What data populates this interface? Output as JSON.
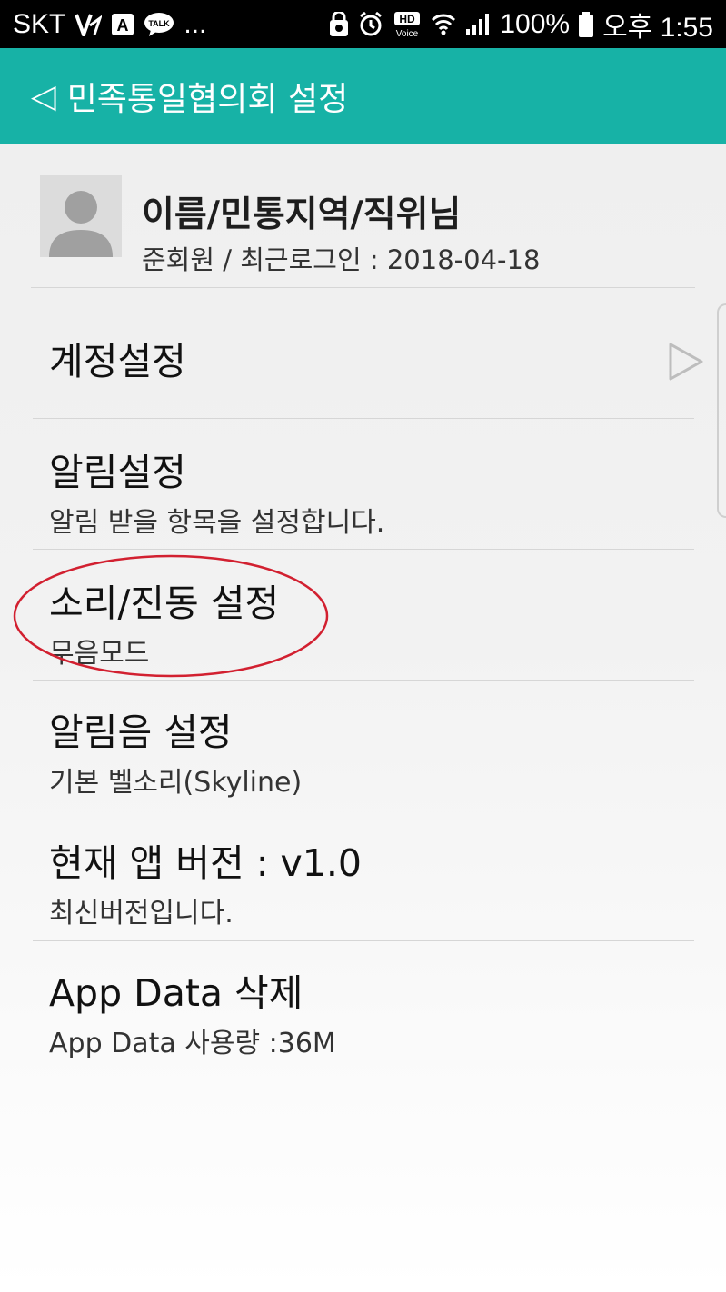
{
  "status_bar": {
    "carrier": "SKT",
    "battery": "100%",
    "time": "오후 1:55",
    "more": "...",
    "hd_voice_top": "HD",
    "hd_voice_bottom": "Voice",
    "talk_badge": "TALK",
    "a_badge": "A"
  },
  "app_bar": {
    "back_icon": "◁",
    "title": "민족통일협의회 설정",
    "color": "#17b2a6"
  },
  "profile": {
    "name": "이름/민통지역/직위님",
    "info": "준회원 / 최근로그인 : 2018-04-18"
  },
  "settings": [
    {
      "title": "계정설정",
      "subtitle": "",
      "has_arrow": true
    },
    {
      "title": "알림설정",
      "subtitle": "알림 받을 항목을 설정합니다."
    },
    {
      "title": "소리/진동 설정",
      "subtitle": "무음모드"
    },
    {
      "title": "알림음 설정",
      "subtitle": "기본 벨소리(Skyline)"
    },
    {
      "title": "현재 앱 버전 : v1.0",
      "subtitle": "최신버전입니다."
    },
    {
      "title": "App Data 삭제",
      "subtitle": "App Data 사용량 :36M"
    }
  ],
  "annotation": {
    "shape": "ellipse",
    "color": "#d22030",
    "target": "소리/진동 설정"
  }
}
